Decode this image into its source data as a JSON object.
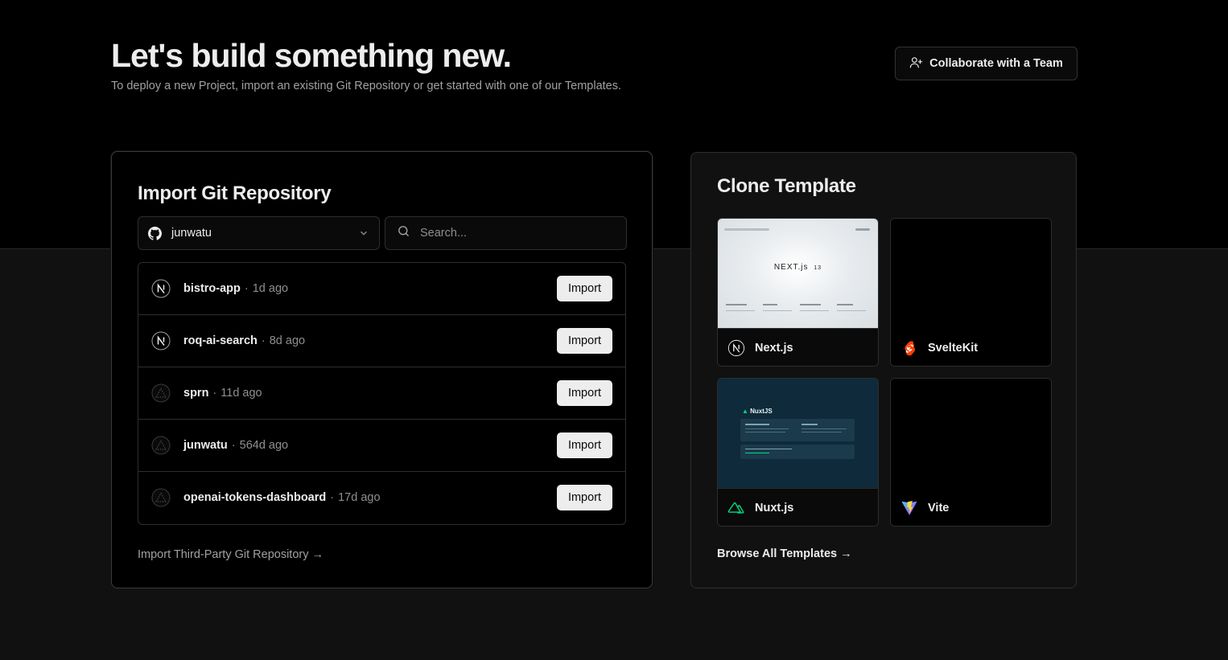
{
  "header": {
    "title": "Let's build something new.",
    "subtitle": "To deploy a new Project, import an existing Git Repository or get started with one of our Templates.",
    "collaborate_label": "Collaborate with a Team"
  },
  "import_card": {
    "title": "Import Git Repository",
    "scope_select": {
      "value": "junwatu",
      "icon": "github-icon"
    },
    "search": {
      "placeholder": "Search..."
    },
    "repos": [
      {
        "name": "bistro-app",
        "age": "1d ago",
        "icon": "nextjs-icon",
        "action": "Import"
      },
      {
        "name": "roq-ai-search",
        "age": "8d ago",
        "icon": "nextjs-icon",
        "action": "Import"
      },
      {
        "name": "sprn",
        "age": "11d ago",
        "icon": "vercel-triangle-icon",
        "action": "Import"
      },
      {
        "name": "junwatu",
        "age": "564d ago",
        "icon": "vercel-triangle-icon",
        "action": "Import"
      },
      {
        "name": "openai-tokens-dashboard",
        "age": "17d ago",
        "icon": "vercel-triangle-icon",
        "action": "Import"
      }
    ],
    "separator": "·",
    "third_party_link": "Import Third-Party Git Repository →"
  },
  "clone_card": {
    "title": "Clone Template",
    "templates": [
      {
        "name": "Next.js",
        "icon": "nextjs-icon"
      },
      {
        "name": "SvelteKit",
        "icon": "svelte-icon",
        "color": "#ff3e00"
      },
      {
        "name": "Nuxt.js",
        "icon": "nuxt-icon",
        "color": "#00dc82"
      },
      {
        "name": "Vite",
        "icon": "vite-icon",
        "color": "#bd34fe"
      }
    ],
    "preview_texts": {
      "next_logo": "NEXT.js",
      "next_version": "13",
      "nuxt_logo": "NuxtJS"
    },
    "browse_link": "Browse All Templates →"
  },
  "colors": {
    "background": "#111111",
    "top_band": "#000000",
    "button_light": "#ededed",
    "nuxt_preview_bg": "#0f2a3a"
  }
}
